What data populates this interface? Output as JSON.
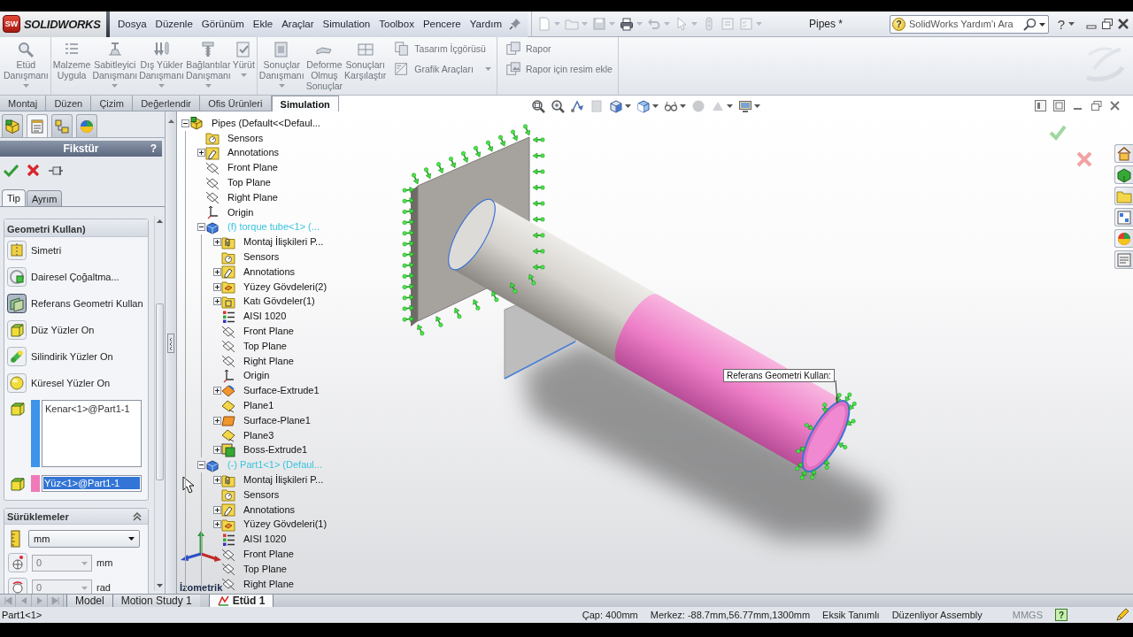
{
  "menu_bar": {
    "logo_mark": "SW",
    "product": "SOLIDWORKS",
    "menus": [
      "Dosya",
      "Düzenle",
      "Görünüm",
      "Ekle",
      "Araçlar",
      "Simulation",
      "Toolbox",
      "Pencere",
      "Yardım"
    ],
    "document_title": "Pipes *",
    "search": {
      "badge": "?",
      "placeholder": "SolidWorks Yardım'ı Ara"
    },
    "help": "?"
  },
  "ribbon": {
    "groups": [
      {
        "items": [
          {
            "kind": "study",
            "label": "Etüd\nDanışmanı",
            "dropdown": true,
            "disabled": true
          }
        ]
      },
      {
        "items": [
          {
            "kind": "material",
            "label": "Malzeme\nUygula",
            "dropdown": false,
            "disabled": true
          },
          {
            "kind": "fixture",
            "label": "Sabitleyici\nDanışmanı",
            "dropdown": true,
            "disabled": true
          },
          {
            "kind": "loads",
            "label": "Dış Yükler\nDanışmanı",
            "dropdown": true,
            "disabled": true
          },
          {
            "kind": "connections",
            "label": "Bağlantılar\nDanışmanı",
            "dropdown": true,
            "disabled": true
          },
          {
            "kind": "run",
            "label": "Yürüt",
            "dropdown": true,
            "disabled": true
          }
        ]
      },
      {
        "items": [
          {
            "kind": "results",
            "label": "Sonuçlar\nDanışmanı",
            "dropdown": true,
            "disabled": true
          },
          {
            "kind": "deformed",
            "label": "Deforme\nOlmuş\nSonuçlar",
            "dropdown": false,
            "disabled": true
          },
          {
            "kind": "compare",
            "label": "Sonuçları\nKarşılaştır",
            "dropdown": false,
            "disabled": true
          },
          {
            "kind": "stack",
            "buttons": [
              {
                "kind": "insight",
                "label": "Tasarım İçgörüsü",
                "dropdown": false,
                "disabled": true
              },
              {
                "kind": "plot_tools",
                "label": "Grafik Araçları",
                "dropdown": true,
                "disabled": true
              }
            ]
          }
        ]
      },
      {
        "items": [
          {
            "kind": "stack",
            "buttons": [
              {
                "kind": "report",
                "label": "Rapor",
                "dropdown": false,
                "disabled": true
              },
              {
                "kind": "report_image",
                "label": "Rapor için resim ekle",
                "dropdown": false,
                "disabled": true
              }
            ]
          }
        ]
      }
    ]
  },
  "command_tabs": [
    {
      "label": "Montaj",
      "selected": false
    },
    {
      "label": "Düzen",
      "selected": false
    },
    {
      "label": "Çizim",
      "selected": false
    },
    {
      "label": "Değerlendir",
      "selected": false
    },
    {
      "label": "Ofis Ürünleri",
      "selected": false
    },
    {
      "label": "Simulation",
      "selected": true
    }
  ],
  "manager_tabs": [
    {
      "kind": "feature_tree",
      "selected": false
    },
    {
      "kind": "property",
      "selected": true
    },
    {
      "kind": "configuration",
      "selected": false
    },
    {
      "kind": "display",
      "selected": false
    }
  ],
  "property_manager": {
    "title": "Fikstür",
    "help": "?",
    "tabs": [
      {
        "label": "Tip",
        "selected": true
      },
      {
        "label": "Ayrım",
        "selected": false
      }
    ],
    "group": {
      "title": "Geometri Kullan)",
      "options": [
        {
          "kind": "symmetry",
          "label": "Simetri",
          "selected": false
        },
        {
          "kind": "circular_pattern",
          "label": "Dairesel Çoğaltma...",
          "selected": false
        },
        {
          "kind": "reference_geometry",
          "label": "Referans Geometri Kullan",
          "selected": true
        },
        {
          "kind": "flat_faces",
          "label": "Düz Yüzler On",
          "selected": false
        },
        {
          "kind": "cylindrical_faces",
          "label": "Silindirik Yüzler On",
          "selected": false
        },
        {
          "kind": "spherical_faces",
          "label": "Küresel Yüzler On",
          "selected": false
        }
      ],
      "selections": [
        {
          "kind": "list",
          "color": "#3d94e8",
          "items": [
            "Kenar<1>@Part1-1"
          ],
          "selected": false
        },
        {
          "kind": "single",
          "color": "#f07ab8",
          "items": [
            "Yüz<1>@Part1-1"
          ],
          "selected": true
        }
      ]
    },
    "translations": {
      "title": "Sürüklemeler",
      "expanded": true,
      "unit": "mm",
      "fields": [
        {
          "kind": "distance",
          "value": "0",
          "unit": "mm",
          "disabled": true
        },
        {
          "kind": "angle",
          "value": "0",
          "unit": "rad",
          "disabled": true
        }
      ]
    }
  },
  "feature_tree": [
    {
      "kind": "assembly",
      "label": "Pipes (Default<<Defaul...",
      "expanded": true,
      "children": [
        {
          "kind": "sensors",
          "label": "Sensors"
        },
        {
          "kind": "annotations",
          "label": "Annotations",
          "expanded": false
        },
        {
          "kind": "plane",
          "label": "Front Plane"
        },
        {
          "kind": "plane",
          "label": "Top Plane"
        },
        {
          "kind": "plane",
          "label": "Right Plane"
        },
        {
          "kind": "origin",
          "label": "Origin"
        },
        {
          "kind": "component",
          "label": "(f) torque tube<1> (...",
          "expanded": true,
          "children": [
            {
              "kind": "mates",
              "label": "Montaj İlişkileri P...",
              "expanded": false
            },
            {
              "kind": "sensors",
              "label": "Sensors"
            },
            {
              "kind": "annotations",
              "label": "Annotations",
              "expanded": false
            },
            {
              "kind": "surface_bodies",
              "label": "Yüzey Gövdeleri(2)",
              "expanded": false
            },
            {
              "kind": "solid_bodies",
              "label": "Katı Gövdeler(1)",
              "expanded": false
            },
            {
              "kind": "material",
              "label": "AISI 1020"
            },
            {
              "kind": "plane",
              "label": "Front Plane"
            },
            {
              "kind": "plane",
              "label": "Top Plane"
            },
            {
              "kind": "plane",
              "label": "Right Plane"
            },
            {
              "kind": "origin",
              "label": "Origin"
            },
            {
              "kind": "surface_extrude",
              "label": "Surface-Extrude1",
              "expanded": false
            },
            {
              "kind": "ref_plane",
              "label": "Plane1"
            },
            {
              "kind": "surface_plane",
              "label": "Surface-Plane1",
              "expanded": false
            },
            {
              "kind": "ref_plane",
              "label": "Plane3"
            },
            {
              "kind": "boss_extrude",
              "label": "Boss-Extrude1",
              "expanded": false
            }
          ]
        },
        {
          "kind": "component",
          "label": "(-) Part1<1> (Defaul...",
          "expanded": true,
          "children": [
            {
              "kind": "mates",
              "label": "Montaj İlişkileri P...",
              "expanded": false
            },
            {
              "kind": "sensors",
              "label": "Sensors"
            },
            {
              "kind": "annotations",
              "label": "Annotations",
              "expanded": false
            },
            {
              "kind": "surface_bodies",
              "label": "Yüzey Gövdeleri(1)",
              "expanded": false
            },
            {
              "kind": "material",
              "label": "AISI 1020"
            },
            {
              "kind": "plane",
              "label": "Front Plane"
            },
            {
              "kind": "plane",
              "label": "Top Plane"
            },
            {
              "kind": "plane",
              "label": "Right Plane"
            }
          ]
        }
      ]
    }
  ],
  "graphics": {
    "tooltip": "Referans Geometri Kullan:",
    "view_name": "İzometrik"
  },
  "bottom_tabs": [
    {
      "kind": "model",
      "label": "Model",
      "selected": false
    },
    {
      "kind": "motion",
      "label": "Motion Study 1",
      "selected": false
    },
    {
      "kind": "study",
      "label": "Etüd 1",
      "selected": true
    }
  ],
  "status_bar": {
    "left": "Part1<1>",
    "items": [
      {
        "text": "Çap: 400mm",
        "disabled": false
      },
      {
        "text": "Merkez: -88.7mm,56.77mm,1300mm",
        "disabled": false
      },
      {
        "text": "Eksik Tanımlı",
        "disabled": false
      },
      {
        "text": "Düzenliyor Assembly",
        "disabled": false
      },
      {
        "text": "MMGS",
        "disabled": true
      }
    ],
    "help": "?"
  }
}
